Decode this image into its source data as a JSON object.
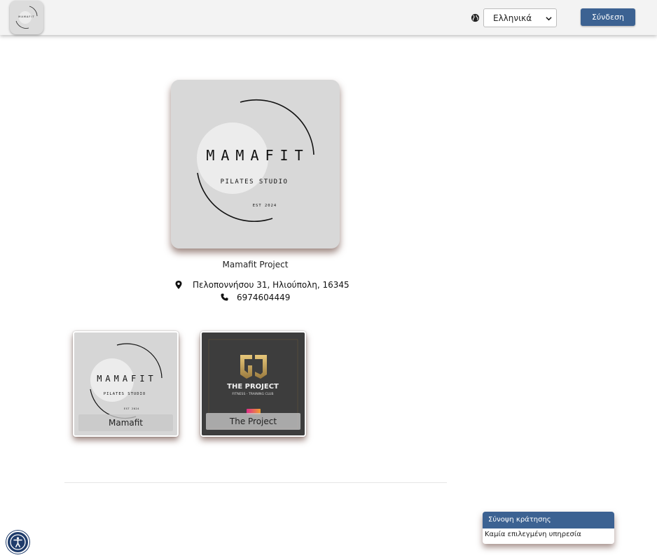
{
  "header": {
    "logo_name": "MAMAFIT",
    "language_selected": "Ελληνικά",
    "login_label": "Σύνδεση",
    "icons": [
      "globe-icon",
      "chevron-down-icon"
    ]
  },
  "business": {
    "logo": {
      "title": "MAMAFIT",
      "subtitle": "PILATES STUDIO",
      "est": "EST 2024"
    },
    "name": "Mamafit Project",
    "address": "Πελοποννήσου 31, Ηλιούπολη, 16345",
    "phone": "6974604449",
    "icons": [
      "map-pin-icon",
      "phone-icon"
    ]
  },
  "locations": [
    {
      "label": "Mamafit",
      "logo_title": "MAMAFIT",
      "logo_subtitle": "PILATES STUDIO",
      "logo_est": "EST 2024"
    },
    {
      "label": "The Project",
      "logo_title": "THE PROJECT",
      "logo_subtitle": "FITNESS - TRAINING CLUB"
    }
  ],
  "summary": {
    "title": "Σύνοψη κράτησης",
    "empty_text": "Καμία επιλεγμένη υπηρεσία"
  },
  "accessibility": {
    "icon": "accessibility-icon"
  },
  "colors": {
    "primary": "#3c6292",
    "header_bg": "#f3f3f3",
    "logo_bg": "#d8d8d8",
    "card_dark_bg": "#3d3d3d"
  }
}
